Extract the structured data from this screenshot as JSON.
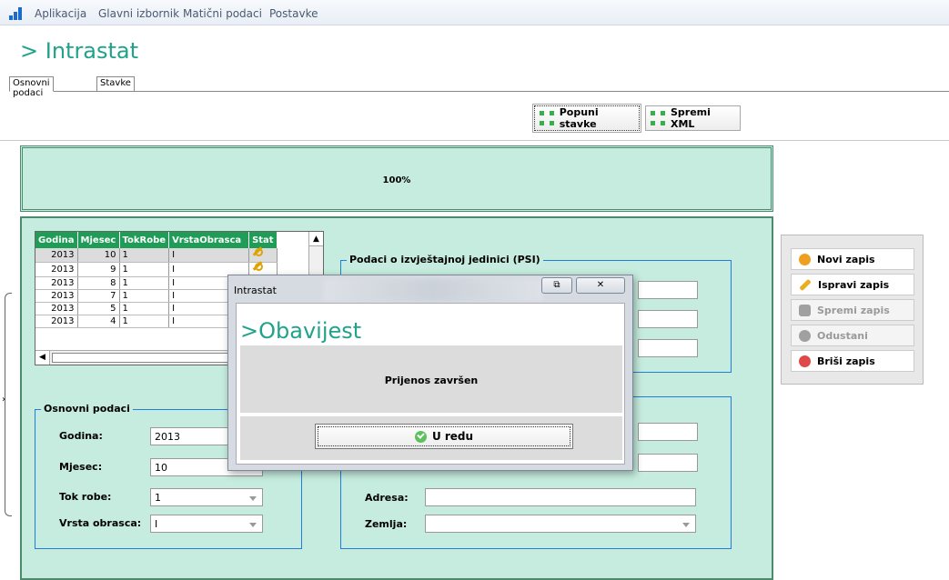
{
  "menu": {
    "items": [
      "Aplikacija",
      "Glavni izbornik",
      "Matični podaci",
      "Postavke"
    ]
  },
  "page_title": "> Intrastat",
  "tabs": [
    {
      "label": "Osnovni podaci",
      "active": true
    },
    {
      "label": "Stavke",
      "active": false
    }
  ],
  "toolbar": {
    "popuni_label": "Popuni stavke",
    "spremi_xml_label": "Spremi XML"
  },
  "progress": {
    "text": "100%",
    "value": 1.0
  },
  "grid": {
    "columns": [
      "Godina",
      "Mjesec",
      "TokRobe",
      "VrstaObrasca",
      "Stat"
    ],
    "rows": [
      {
        "godina": "2013",
        "mjesec": "10",
        "tok": "1",
        "vrsta": "I",
        "selected": true
      },
      {
        "godina": "2013",
        "mjesec": "9",
        "tok": "1",
        "vrsta": "I",
        "selected": false
      },
      {
        "godina": "2013",
        "mjesec": "8",
        "tok": "1",
        "vrsta": "I",
        "selected": false
      },
      {
        "godina": "2013",
        "mjesec": "7",
        "tok": "1",
        "vrsta": "I",
        "selected": false
      },
      {
        "godina": "2013",
        "mjesec": "5",
        "tok": "1",
        "vrsta": "I",
        "selected": false
      },
      {
        "godina": "2013",
        "mjesec": "4",
        "tok": "1",
        "vrsta": "I",
        "selected": false
      }
    ]
  },
  "psi": {
    "legend": "Podaci o izvještajnoj jedinici (PSI)"
  },
  "osnovni": {
    "legend": "Osnovni podaci",
    "godina_label": "Godina:",
    "godina_value": "2013",
    "mjesec_label": "Mjesec:",
    "mjesec_value": "10",
    "tok_label": "Tok robe:",
    "tok_value": "1",
    "vrsta_label": "Vrsta obrasca:",
    "vrsta_value": "I"
  },
  "second": {
    "adresa_label": "Adresa:",
    "adresa_value": "",
    "zemlja_label": "Zemlja:",
    "zemlja_value": ""
  },
  "side_buttons": [
    {
      "label": "Novi zapis",
      "enabled": true,
      "icon": "plus-icon",
      "color": "#f0a020"
    },
    {
      "label": "Ispravi zapis",
      "enabled": true,
      "icon": "pencil-icon",
      "color": "#e8b020"
    },
    {
      "label": "Spremi zapis",
      "enabled": false,
      "icon": "save-check-icon",
      "color": "#a0a0a0"
    },
    {
      "label": "Odustani",
      "enabled": false,
      "icon": "cancel-icon",
      "color": "#a0a0a0"
    },
    {
      "label": "Briši zapis",
      "enabled": true,
      "icon": "minus-icon",
      "color": "#e04848"
    }
  ],
  "modal": {
    "window_title": "Intrastat",
    "heading": ">Obavijest",
    "message": "Prijenos završen",
    "ok_label": "U redu"
  },
  "colors": {
    "accent": "#21a28a",
    "panel_bg": "#c5ecde",
    "grid_header": "#1f9d57"
  }
}
